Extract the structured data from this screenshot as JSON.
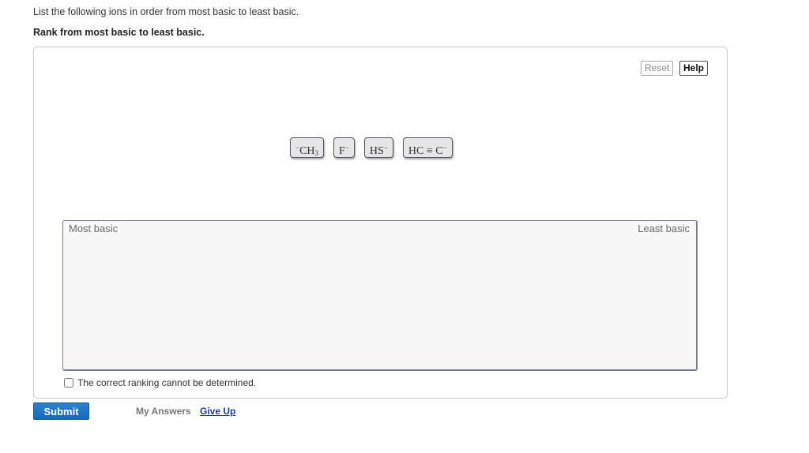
{
  "question": {
    "prompt": "List the following ions in order from most basic to least basic.",
    "instruction": "Rank from most basic to least basic."
  },
  "toolbar": {
    "reset_label": "Reset",
    "help_label": "Help"
  },
  "tiles": [
    {
      "prefix_sup": "−",
      "main": "CH",
      "sub": "3",
      "suffix_sup": ""
    },
    {
      "prefix_sup": "",
      "main": "F",
      "sub": "",
      "suffix_sup": "−"
    },
    {
      "prefix_sup": "",
      "main": "HS",
      "sub": "",
      "suffix_sup": "−"
    },
    {
      "prefix_sup": "",
      "main": "HC ≡ C",
      "sub": "",
      "suffix_sup": "−"
    }
  ],
  "ranking": {
    "left_label": "Most basic",
    "right_label": "Least basic"
  },
  "cannot_determine": {
    "label": "The correct ranking cannot be determined.",
    "checked": false
  },
  "footer": {
    "submit_label": "Submit",
    "my_answers_label": "My Answers",
    "give_up_label": "Give Up"
  }
}
